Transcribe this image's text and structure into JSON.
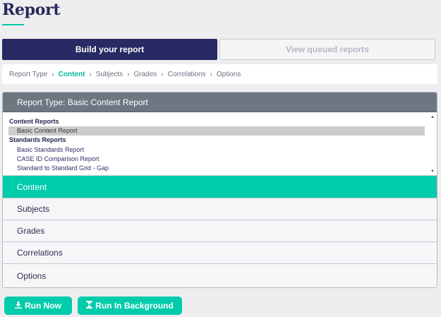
{
  "page": {
    "title": "Report"
  },
  "tabs": {
    "build": "Build your report",
    "queued": "View queued reports"
  },
  "breadcrumb": [
    "Report Type",
    "Content",
    "Subjects",
    "Grades",
    "Correlations",
    "Options"
  ],
  "breadcrumb_active_index": 1,
  "panel": {
    "header": "Report Type: Basic Content Report",
    "list": {
      "groups": [
        {
          "label": "Content Reports",
          "options": [
            "Basic Content Report"
          ]
        },
        {
          "label": "Standards Reports",
          "options": [
            "Basic Standards Report",
            "CASE ID Comparison Report",
            "Standard to Standard Grid - Gap"
          ]
        }
      ],
      "selected": "Basic Content Report"
    },
    "sections": [
      "Content",
      "Subjects",
      "Grades",
      "Correlations",
      "Options"
    ],
    "active_section": "Content"
  },
  "actions": {
    "run_now": "Run Now",
    "run_background": "Run In Background"
  },
  "icons": {
    "run_now": "download-icon",
    "run_background": "hourglass-icon"
  },
  "colors": {
    "accent": "#00cbab",
    "primary": "#272a63",
    "header": "#6e7781"
  }
}
